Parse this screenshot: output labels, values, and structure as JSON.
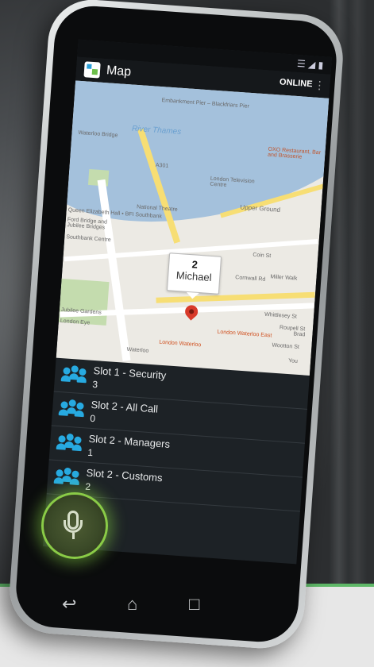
{
  "app": {
    "title": "Map",
    "status": "ONLINE"
  },
  "map": {
    "labels": {
      "river": "River Thames",
      "embankment": "Embankment Pier – Blackfriars Pier",
      "waterloo_bridge": "Waterloo Bridge",
      "oxo": "OXO Restaurant, Bar and Brasserie",
      "london_tv": "London Television Centre",
      "upper_ground": "Upper Ground",
      "national_theatre": "National Theatre",
      "queen_elizabeth": "Queen Elizabeth Hall • BFI Southbank",
      "jubilee": "Ford Bridge and Jubilee Bridges",
      "southbank": "Southbank Centre",
      "whittlesey": "Whittlesey St",
      "roupell": "Roupell St",
      "waterloo_east": "London Waterloo East",
      "waterloo_station": "London Waterloo",
      "waterloo": "Waterloo",
      "eye": "London Eye",
      "cornwall": "Cornwall Rd",
      "wootton": "Wootton St",
      "gardens": "Jubilee Gardens",
      "brad": "Brad",
      "you": "You",
      "broadway": "Broadwall",
      "colin": "Coin St",
      "miller": "Miller Walk",
      "a301": "A301"
    },
    "marker": {
      "number": "2",
      "name": "Michael"
    }
  },
  "slots": [
    {
      "name": "Slot 1 - Security",
      "count": "3"
    },
    {
      "name": "Slot 2 - All Call",
      "count": "0"
    },
    {
      "name": "Slot 2 - Managers",
      "count": "1"
    },
    {
      "name": "Slot 2 - Customs",
      "count": "2"
    }
  ],
  "icons": {
    "wifi": "wifi-icon",
    "signal": "signal-icon",
    "battery": "battery-icon",
    "mic": "microphone-icon",
    "back": "back-icon",
    "home": "home-icon",
    "recents": "recents-icon",
    "group": "group-icon"
  },
  "colors": {
    "accent": "#27aae1",
    "ptt_green": "#8acb47",
    "brand_line": "#5fb868"
  }
}
